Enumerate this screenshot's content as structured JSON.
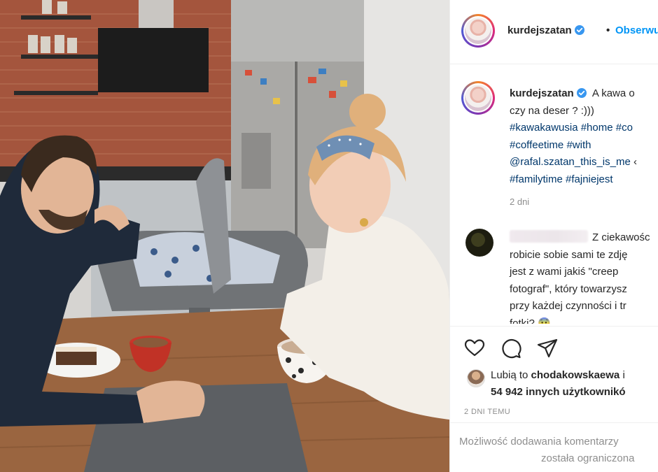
{
  "header": {
    "username": "kurdejszatan",
    "separator": "•",
    "follow_label": "Obserwuj"
  },
  "caption": {
    "username": "kurdejszatan",
    "line1_text": "A kawa o",
    "line2": "czy na deser ? :)))",
    "line3": "#kawakawusia #home #co",
    "line4": "#coffeetime #with",
    "line5_mention": "@rafal.szatan_this_is_me",
    "line5_tail": " ‹",
    "line6": "#familytime #fajniejest",
    "time": "2 dni"
  },
  "comment": {
    "line1": "Z ciekawośc",
    "line2": "robicie sobie sami te zdję",
    "line3": "jest z wami jakiś \"creep",
    "line4": "fotograf\", który towarzysz",
    "line5": "przy każdej czynności i tr",
    "line6": "fotki? 😨"
  },
  "likes": {
    "prefix": "Lubią to ",
    "user": "chodakowskaewa",
    "suffix": " i",
    "count_line": "54 942 innych użytkownikó"
  },
  "date": "2 DNI TEMU",
  "footer": {
    "line1": "Możliwość dodawania komentarzy",
    "line2": "została ograniczona"
  },
  "icons": [
    "verified-badge-icon",
    "heart-icon",
    "comment-icon",
    "share-icon"
  ],
  "colors": {
    "link_blue": "#0095f6",
    "hashtag_blue": "#00376b",
    "muted_gray": "#8e8e8e",
    "text_dark": "#262626"
  }
}
